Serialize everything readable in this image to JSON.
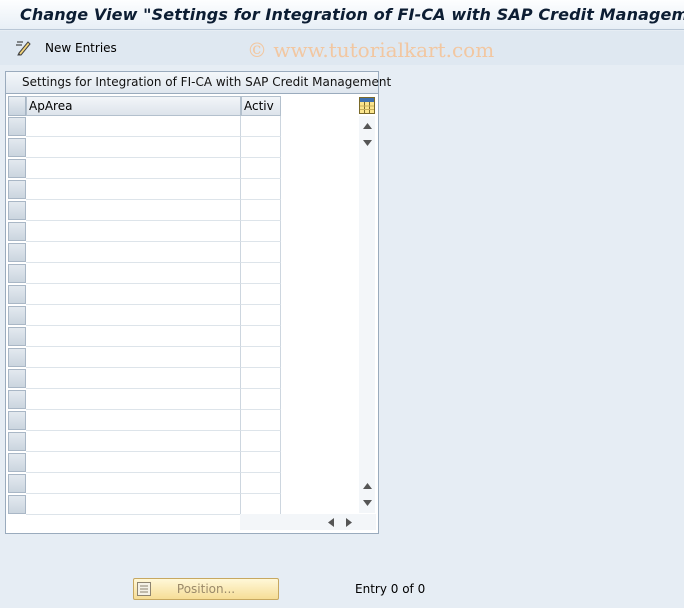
{
  "window": {
    "title": "Change View \"Settings for Integration of FI-CA with SAP Credit Managem"
  },
  "toolbar": {
    "new_entries_label": "New Entries",
    "new_entries_icon": "new-entries-pencil-icon",
    "watermark": "© www.tutorialkart.com"
  },
  "table": {
    "title": "Settings for Integration of FI-CA with SAP Credit Management",
    "columns": [
      {
        "label": "ApArea"
      },
      {
        "label": "Activ"
      }
    ],
    "rows": [
      [
        "",
        ""
      ],
      [
        "",
        ""
      ],
      [
        "",
        ""
      ],
      [
        "",
        ""
      ],
      [
        "",
        ""
      ],
      [
        "",
        ""
      ],
      [
        "",
        ""
      ],
      [
        "",
        ""
      ],
      [
        "",
        ""
      ],
      [
        "",
        ""
      ],
      [
        "",
        ""
      ],
      [
        "",
        ""
      ],
      [
        "",
        ""
      ],
      [
        "",
        ""
      ],
      [
        "",
        ""
      ],
      [
        "",
        ""
      ],
      [
        "",
        ""
      ],
      [
        "",
        ""
      ],
      [
        "",
        ""
      ]
    ],
    "config_icon": "table-settings-icon"
  },
  "footer": {
    "position_label": "Position...",
    "entry_info": "Entry 0 of 0"
  },
  "colors": {
    "background": "#e6edf4",
    "title_text": "#0c1d33",
    "watermark": "#f2c7a1",
    "position_button": "#f6dd96"
  }
}
